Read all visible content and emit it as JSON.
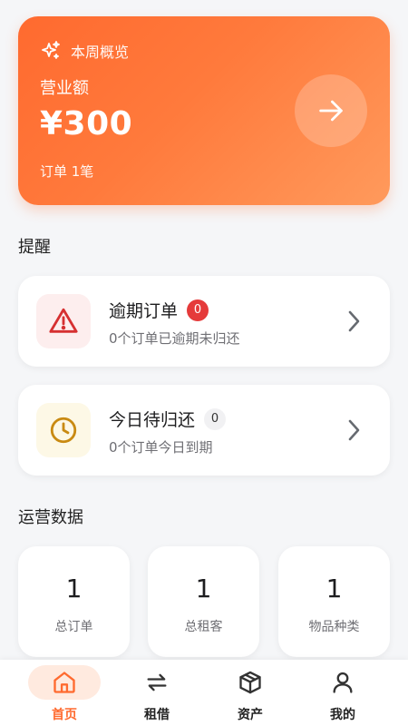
{
  "colors": {
    "accent": "#ff6a2f",
    "danger": "#e53a3a",
    "warning": "#c98a12"
  },
  "overview": {
    "title": "本周概览",
    "revenue_label": "营业额",
    "revenue_amount": "¥300",
    "orders_text": "订单 1笔",
    "icon": "sparkle-icon",
    "action_icon": "arrow-right-icon"
  },
  "reminders": {
    "section_title": "提醒",
    "items": [
      {
        "title": "逾期订单",
        "count": "0",
        "subtitle": "0个订单已逾期未归还",
        "icon": "warning-icon"
      },
      {
        "title": "今日待归还",
        "count": "0",
        "subtitle": "0个订单今日到期",
        "icon": "clock-icon"
      }
    ]
  },
  "operations": {
    "section_title": "运营数据",
    "stats": [
      {
        "value": "1",
        "label": "总订单"
      },
      {
        "value": "1",
        "label": "总租客"
      },
      {
        "value": "1",
        "label": "物品种类"
      }
    ]
  },
  "tabbar": {
    "active": "home",
    "items": [
      {
        "key": "home",
        "label": "首页",
        "icon": "home-icon"
      },
      {
        "key": "rent",
        "label": "租借",
        "icon": "swap-icon"
      },
      {
        "key": "assets",
        "label": "资产",
        "icon": "box-icon"
      },
      {
        "key": "mine",
        "label": "我的",
        "icon": "user-icon"
      }
    ]
  }
}
